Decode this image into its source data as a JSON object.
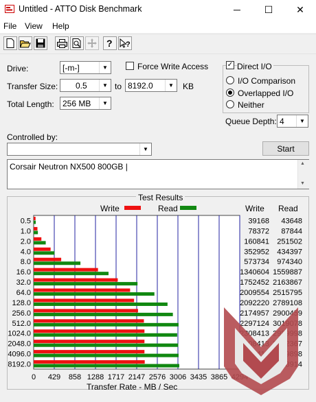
{
  "window": {
    "title": "Untitled - ATTO Disk Benchmark",
    "minimize": "─",
    "maximize": "☐",
    "close": "✕"
  },
  "menu": {
    "file": "File",
    "view": "View",
    "help": "Help"
  },
  "toolbar": [
    "new-icon",
    "open-icon",
    "save-icon",
    "print-icon",
    "print-preview-icon",
    "move-icon",
    "help-icon",
    "context-help-icon"
  ],
  "settings": {
    "drive_label": "Drive:",
    "drive_value": "[-m-]",
    "force_write_label": "Force Write Access",
    "force_write_checked": false,
    "transfer_size_label": "Transfer Size:",
    "transfer_from": "0.5",
    "to_label": "to",
    "transfer_to": "8192.0",
    "kb_label": "KB",
    "total_length_label": "Total Length:",
    "total_length_value": "256 MB",
    "direct_io_label": "Direct I/O",
    "direct_io_checked": "✓",
    "io_comparison_label": "I/O Comparison",
    "overlapped_io_label": "Overlapped I/O",
    "neither_label": "Neither",
    "queue_depth_label": "Queue Depth:",
    "queue_depth_value": "4",
    "controlled_by_label": "Controlled by:",
    "controlled_by_value": "",
    "start_label": "Start",
    "description": "Corsair Neutron NX500 800GB |"
  },
  "results": {
    "title": "Test Results",
    "write_legend": "Write",
    "read_legend": "Read",
    "write_col": "Write",
    "read_col": "Read",
    "xlabel": "Transfer Rate - MB / Sec",
    "colors": {
      "write": "#ee1111",
      "read": "#118811",
      "grid": "#2020a0"
    }
  },
  "chart_data": {
    "type": "bar",
    "xlim": [
      0,
      4294
    ],
    "xticks": [
      "0",
      "429",
      "858",
      "1288",
      "1717",
      "2147",
      "2576",
      "3006",
      "3435",
      "3865",
      "4294"
    ],
    "categories": [
      "0.5",
      "1.0",
      "2.0",
      "4.0",
      "8.0",
      "16.0",
      "32.0",
      "64.0",
      "128.0",
      "256.0",
      "512.0",
      "1024.0",
      "2048.0",
      "4096.0",
      "8192.0"
    ],
    "series": [
      {
        "name": "Write",
        "values": [
          39168,
          78372,
          160841,
          352952,
          573734,
          1340604,
          1752452,
          2009554,
          2092220,
          2174957,
          2297124,
          2308413,
          2308413,
          2308413,
          2314098
        ]
      },
      {
        "name": "Read",
        "values": [
          43648,
          87844,
          251502,
          434397,
          974340,
          1559887,
          2163867,
          2515795,
          2789108,
          2900459,
          3019078,
          2989998,
          3012367,
          3019898,
          3033914
        ]
      }
    ],
    "bar_units_per_value": 0.001
  },
  "watermark": "KitGuru logo"
}
